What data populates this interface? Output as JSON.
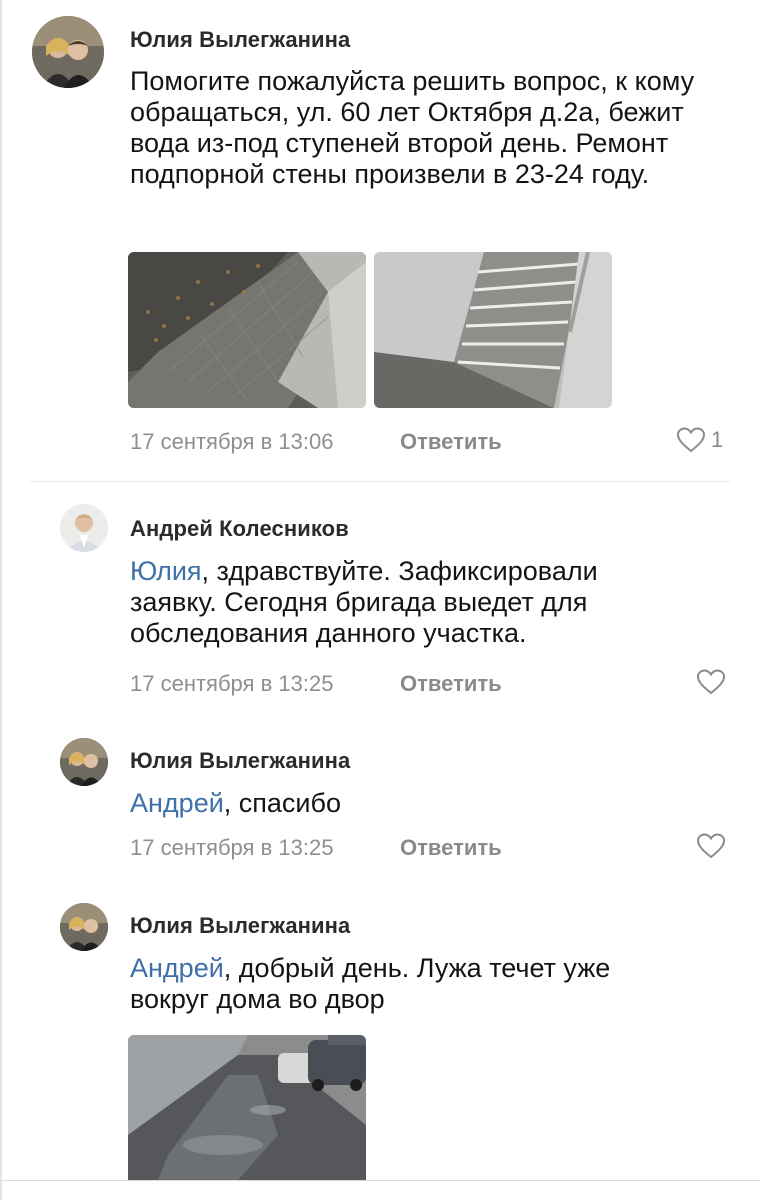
{
  "comments": [
    {
      "author": "Юлия Вылегжанина",
      "text": "Помогите пожалуйста решить вопрос, к кому обращаться,  ул. 60 лет Октября д.2а, бежит вода из-под ступеней второй день. Ремонт подпорной стены произвели в 23-24 году.",
      "time": "17 сентября в 13:06",
      "reply_label": "Ответить",
      "likes": "1",
      "photos": [
        "street-tiles-photo",
        "stairs-photo"
      ]
    },
    {
      "author": "Андрей Колесников",
      "mention": "Юлия",
      "text": ", здравствуйте. Зафиксировали заявку. Сегодня бригада выедет для обследования данного участка.",
      "time": "17 сентября в 13:25",
      "reply_label": "Ответить"
    },
    {
      "author": "Юлия Вылегжанина",
      "mention": "Андрей",
      "text": ", спасибо",
      "time": "17 сентября в 13:25",
      "reply_label": "Ответить"
    },
    {
      "author": "Юлия Вылегжанина",
      "mention": "Андрей",
      "text": ", добрый день. Лужа течет уже вокруг дома во двор",
      "photos": [
        "puddle-yard-photo"
      ]
    }
  ],
  "icons": {
    "like": "heart-outline-icon"
  },
  "colors": {
    "mention": "#3f70a8",
    "meta": "#8f8f8f",
    "icon": "#888888"
  }
}
